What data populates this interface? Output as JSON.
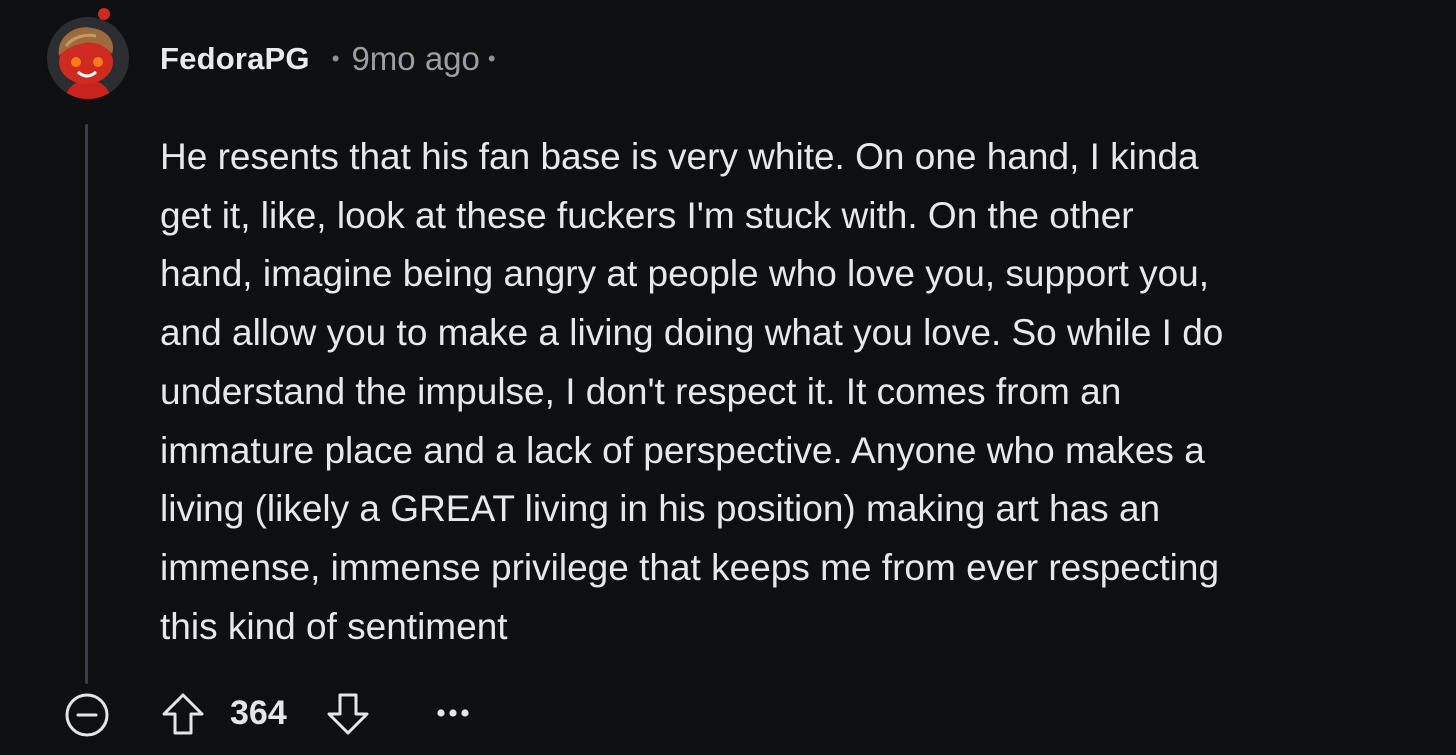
{
  "comment": {
    "username": "FedoraPG",
    "separator": "•",
    "timestamp": "9mo ago",
    "body_lines": [
      "He resents that his fan base is very white. On one hand, I kinda",
      "get it, like, look at these fuckers I'm stuck with. On the other",
      "hand, imagine being angry at people who love you, support you,",
      "and allow you to make a living doing what you love. So while I do",
      "understand the impulse, I don't respect it. It comes from an",
      "immature place and a lack of perspective. Anyone who makes a",
      "living (likely a GREAT living in his position) making art has an",
      "immense, immense privilege that keeps me from ever respecting",
      "this kind of sentiment"
    ]
  },
  "actions": {
    "score": "364",
    "collapse_icon": "minus-circle-icon",
    "upvote_icon": "arrow-up-outline-icon",
    "downvote_icon": "arrow-down-outline-icon",
    "more_icon": "ellipsis-icon"
  },
  "colors": {
    "background": "#0e0f11",
    "text": "#e6e8eb",
    "muted": "#9a9ea4",
    "avatar_red": "#c8231c"
  }
}
